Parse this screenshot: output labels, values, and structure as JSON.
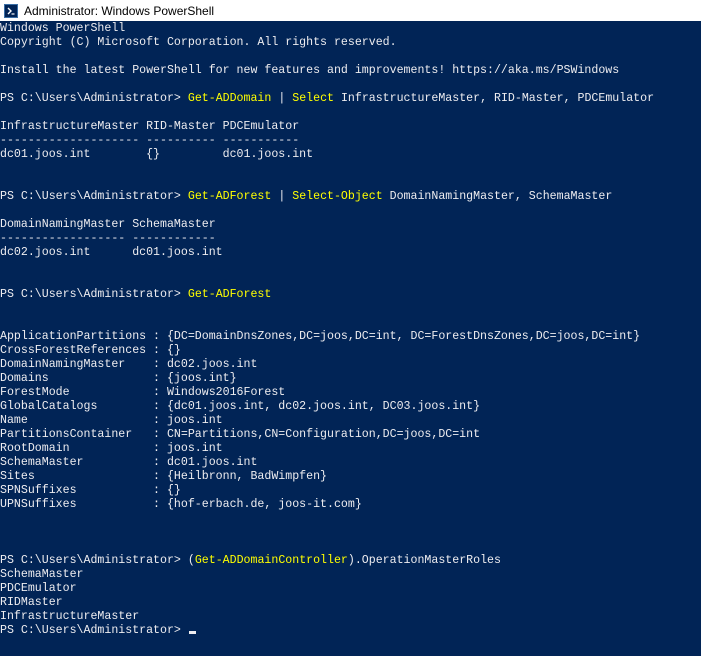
{
  "window": {
    "title": "Administrator: Windows PowerShell",
    "icon": "powershell-icon"
  },
  "colors": {
    "background": "#012456",
    "text": "#eeedf0",
    "command": "#ffff00"
  },
  "console": {
    "banner": [
      "Windows PowerShell",
      "Copyright (C) Microsoft Corporation. All rights reserved.",
      "Install the latest PowerShell for new features and improvements! https://aka.ms/PSWindows"
    ],
    "prompt": "PS C:\\Users\\Administrator> ",
    "cmd1": {
      "name1": "Get-ADDomain",
      "pipe": " | ",
      "name2": "Select",
      "args": " InfrastructureMaster, RID-Master, PDCEmulator"
    },
    "out1": [
      "InfrastructureMaster RID-Master PDCEmulator",
      "-------------------- ---------- -----------",
      "dc01.joos.int        {}         dc01.joos.int"
    ],
    "cmd2": {
      "name1": "Get-ADForest",
      "pipe": " | ",
      "name2": "Select-Object",
      "args": " DomainNamingMaster, SchemaMaster"
    },
    "out2": [
      "DomainNamingMaster SchemaMaster",
      "------------------ ------------",
      "dc02.joos.int      dc01.joos.int"
    ],
    "cmd3": {
      "name1": "Get-ADForest"
    },
    "forest": [
      "ApplicationPartitions : {DC=DomainDnsZones,DC=joos,DC=int, DC=ForestDnsZones,DC=joos,DC=int}",
      "CrossForestReferences : {}",
      "DomainNamingMaster    : dc02.joos.int",
      "Domains               : {joos.int}",
      "ForestMode            : Windows2016Forest",
      "GlobalCatalogs        : {dc01.joos.int, dc02.joos.int, DC03.joos.int}",
      "Name                  : joos.int",
      "PartitionsContainer   : CN=Partitions,CN=Configuration,DC=joos,DC=int",
      "RootDomain            : joos.int",
      "SchemaMaster          : dc01.joos.int",
      "Sites                 : {Heilbronn, BadWimpfen}",
      "SPNSuffixes           : {}",
      "UPNSuffixes           : {hof-erbach.de, joos-it.com}"
    ],
    "cmd4": {
      "open": "(",
      "name1": "Get-ADDomainController",
      "rest": ").OperationMasterRoles"
    },
    "roles": [
      "SchemaMaster",
      "PDCEmulator",
      "RIDMaster",
      "InfrastructureMaster"
    ],
    "final_prompt": "PS C:\\Users\\Administrator> "
  }
}
